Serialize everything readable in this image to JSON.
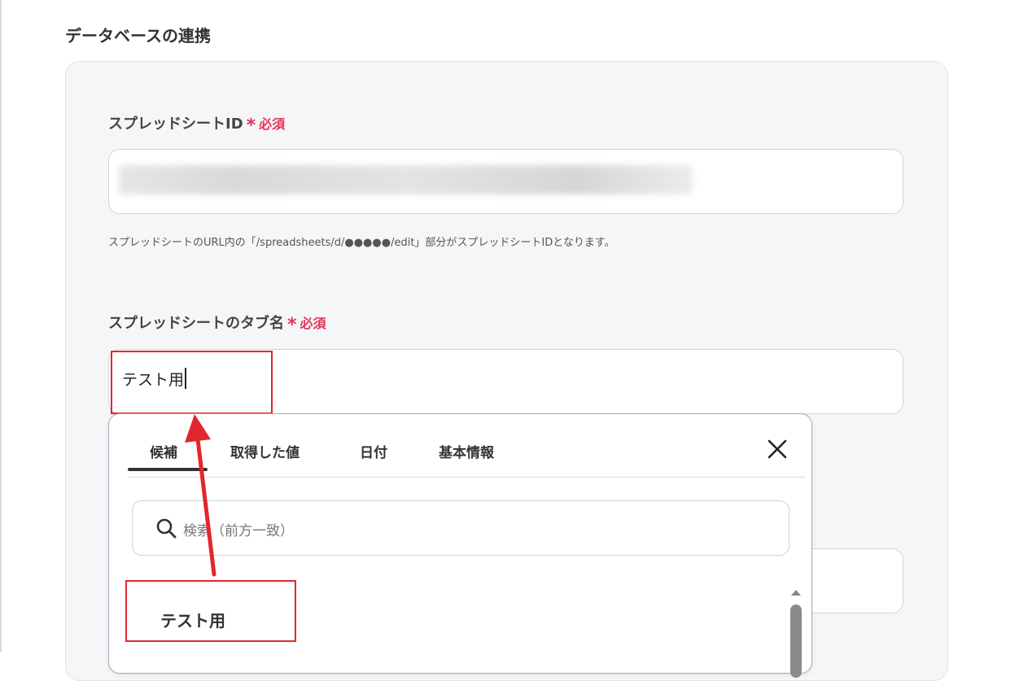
{
  "section": {
    "title": "データベースの連携"
  },
  "spreadsheet_id": {
    "label": "スプレッドシートID",
    "required_mark": "*",
    "required_text": "必須",
    "help": "スプレッドシートのURL内の「/spreadsheets/d/●●●●●/edit」部分がスプレッドシートIDとなります。"
  },
  "tab_name": {
    "label": "スプレッドシートのタブ名",
    "required_mark": "*",
    "required_text": "必須",
    "value": "テスト用"
  },
  "popup": {
    "tabs": [
      "候補",
      "取得した値",
      "日付",
      "基本情報"
    ],
    "active_tab": "候補",
    "search_placeholder": "検索（前方一致）",
    "options": [
      "テスト用"
    ]
  },
  "colors": {
    "required": "#e4345a",
    "highlight": "#e3262e",
    "card_bg": "#f5f6f8"
  },
  "icons": [
    "close-icon",
    "search-icon",
    "scroll-up-icon"
  ]
}
